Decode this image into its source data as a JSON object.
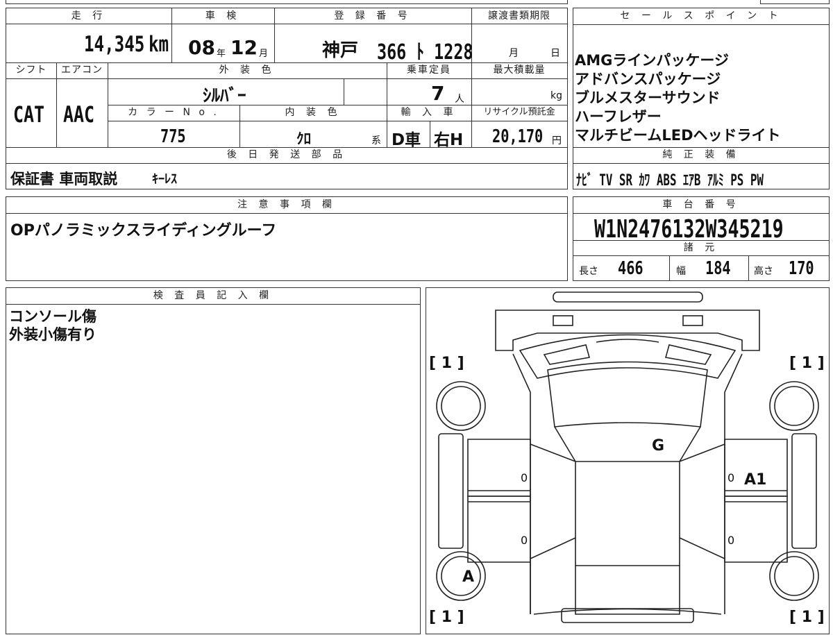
{
  "top": {
    "mileage_label": "走 行",
    "mileage_value": "14,345",
    "mileage_unit": "km",
    "inspection_label": "車 検",
    "inspection_year": "08",
    "inspection_year_unit": "年",
    "inspection_month": "12",
    "inspection_month_unit": "月",
    "registration_label": "登 録 番 号",
    "registration_place": "神戸",
    "registration_number": "366 ﾄ 1228",
    "transfer_label": "譲渡書類期限",
    "transfer_month_unit": "月",
    "transfer_day_unit": "日"
  },
  "row2": {
    "shift_label": "シフト",
    "ac_label": "エアコン",
    "exterior_label": "外 装 色",
    "capacity_label": "乗車定員",
    "maxload_label": "最大積載量",
    "shift_value": "CAT",
    "ac_value": "AAC",
    "exterior_value": "ｼﾙﾊﾞｰ",
    "capacity_value": "7",
    "capacity_unit": "人",
    "maxload_unit": "kg",
    "color_no_label": "カ ラ ー N o .",
    "interior_label": "内 装 色",
    "import_label": "輸 入 車",
    "recycle_label": "リサイクル預託金",
    "color_no_value": "775",
    "interior_value": "ｸﾛ",
    "interior_unit": "系",
    "import_value": "D車",
    "handle_value": "右H",
    "recycle_value": "20,170",
    "recycle_unit": "円"
  },
  "later_parts": {
    "label": "後 日 発 送 部 品",
    "value_main": "保証書 車両取説",
    "value_extra": "ｷｰﾚｽ"
  },
  "sales_points": {
    "label": "セ ー ル ス ポ イ ン ト",
    "items": [
      "AMGラインパッケージ",
      "アドバンスパッケージ",
      "ブルメスターサウンド",
      "ハーフレザー",
      "マルチビームLEDヘッドライト"
    ]
  },
  "genuine_equipment": {
    "label": "純 正 装 備",
    "value": "ﾅﾋﾞ TV SR ｶﾜ ABS ｴｱB ｱﾙﾐ PS PW"
  },
  "notes": {
    "label": "注 意 事 項 欄",
    "value": "OPパノラミックスライディングルーフ"
  },
  "chassis": {
    "label": "車 台 番 号",
    "value": "W1N2476132W345219",
    "spec_label": "諸 元",
    "length_label": "長さ",
    "length_value": "466",
    "width_label": "幅",
    "width_value": "184",
    "height_label": "高さ",
    "height_value": "170"
  },
  "inspector": {
    "label": "検 査 員 記 入 欄",
    "lines": [
      "コンソール傷",
      "外装小傷有り"
    ]
  },
  "diagram": {
    "tl": "[ 1 ]",
    "tr": "[ 1 ]",
    "bl": "[ 1 ]",
    "br": "[ 1 ]",
    "mark_g": "G",
    "mark_a1": "A1",
    "mark_a": "A",
    "zero_1": "0",
    "zero_2": "0",
    "zero_3": "0",
    "zero_4": "0"
  }
}
